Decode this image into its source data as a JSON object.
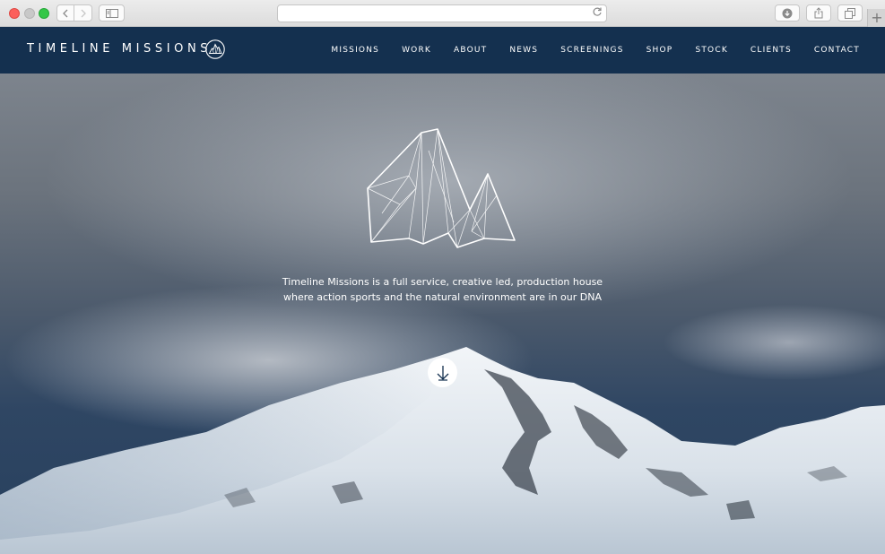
{
  "browser": {
    "back_icon": "chevron-left-icon",
    "forward_icon": "chevron-right-icon",
    "reload_icon": "reload-icon",
    "plus_label": "+"
  },
  "site": {
    "brand": "TIMELINE MISSIONS",
    "nav": [
      "MISSIONS",
      "WORK",
      "ABOUT",
      "NEWS",
      "SCREENINGS",
      "SHOP",
      "STOCK",
      "CLIENTS",
      "CONTACT"
    ],
    "colors": {
      "nav_bg": "#14304f",
      "text": "#ffffff"
    }
  },
  "hero": {
    "tagline_line1": "Timeline Missions is a full service, creative led, production house",
    "tagline_line2": "where action sports and the natural environment are in our DNA",
    "scroll_icon": "arrow-down-icon"
  }
}
